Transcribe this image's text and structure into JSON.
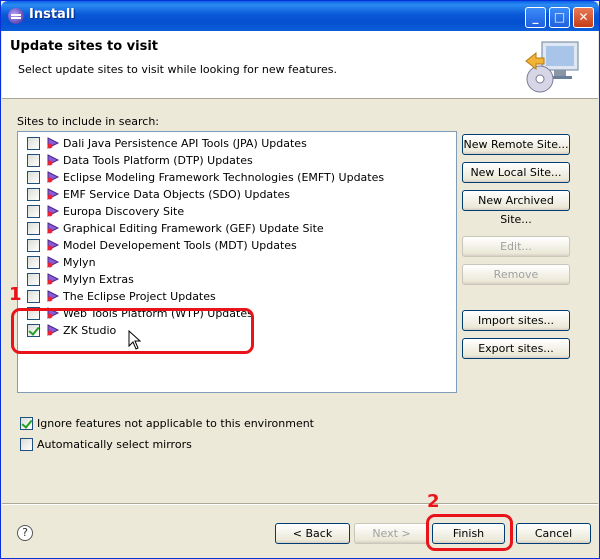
{
  "window": {
    "title": "Install"
  },
  "title_buttons": {
    "minimize": "_",
    "maximize": "□",
    "close": "✕"
  },
  "header": {
    "title": "Update sites to visit",
    "description": "Select update sites to visit while looking for new features.",
    "icon": "install-cd-icon"
  },
  "sites_label": "Sites to include in search:",
  "sites": [
    {
      "label": "Dali Java Persistence API Tools (JPA) Updates",
      "checked": false
    },
    {
      "label": "Data Tools Platform (DTP) Updates",
      "checked": false
    },
    {
      "label": "Eclipse Modeling Framework Technologies (EMFT) Updates",
      "checked": false
    },
    {
      "label": "EMF Service Data Objects (SDO) Updates",
      "checked": false
    },
    {
      "label": "Europa Discovery Site",
      "checked": false
    },
    {
      "label": "Graphical Editing Framework (GEF) Update Site",
      "checked": false
    },
    {
      "label": "Model Developement Tools (MDT) Updates",
      "checked": false
    },
    {
      "label": "Mylyn",
      "checked": false
    },
    {
      "label": "Mylyn Extras",
      "checked": false
    },
    {
      "label": "The Eclipse Project Updates",
      "checked": false
    },
    {
      "label": "Web Tools Platform (WTP) Updates",
      "checked": false
    },
    {
      "label": "ZK Studio",
      "checked": true
    }
  ],
  "side_buttons": {
    "new_remote": "New Remote Site...",
    "new_local": "New Local Site...",
    "new_archived": "New Archived Site...",
    "edit": "Edit...",
    "remove": "Remove",
    "import": "Import sites...",
    "export": "Export sites..."
  },
  "options": {
    "ignore_features": {
      "label": "Ignore features not applicable to this environment",
      "checked": true
    },
    "auto_mirrors": {
      "label": "Automatically select mirrors",
      "checked": false
    }
  },
  "footer": {
    "help": "?",
    "back": "< Back",
    "next": "Next >",
    "finish": "Finish",
    "cancel": "Cancel"
  },
  "annotations": {
    "step1": "1",
    "step2": "2"
  },
  "colors": {
    "annotation": "#e8141a",
    "titlebar": "#0a59d8",
    "dialog_bg": "#ece9d8"
  }
}
